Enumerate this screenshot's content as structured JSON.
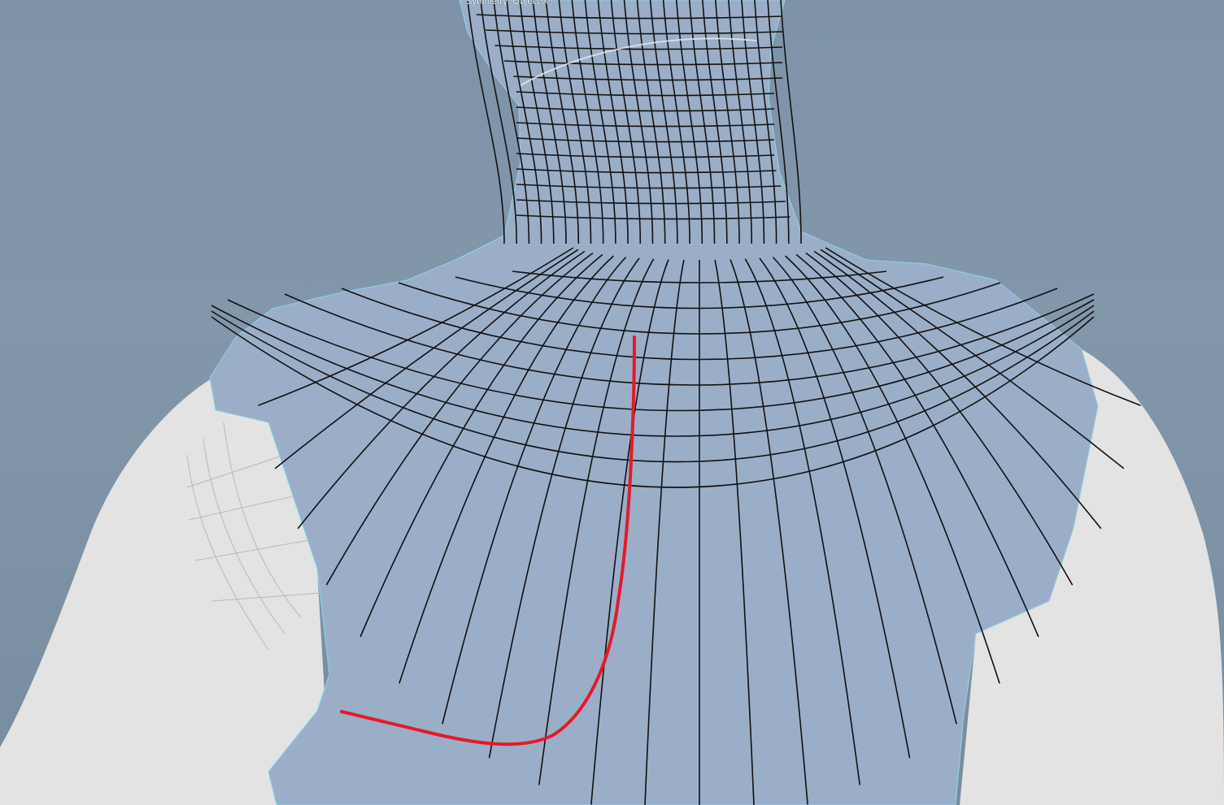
{
  "viewport": {
    "hud": {
      "symmetry_label": "Symmetry: Object X"
    },
    "colors": {
      "background_top": "#7e93a8",
      "background_bottom": "#788c9f",
      "mesh_selected": "#9aadc8",
      "mesh_unselected": "#e4e4e4",
      "wireframe": "#101010",
      "annotation_stroke": "#e41a2a",
      "selection_highlight": "#8fd3e8"
    }
  }
}
